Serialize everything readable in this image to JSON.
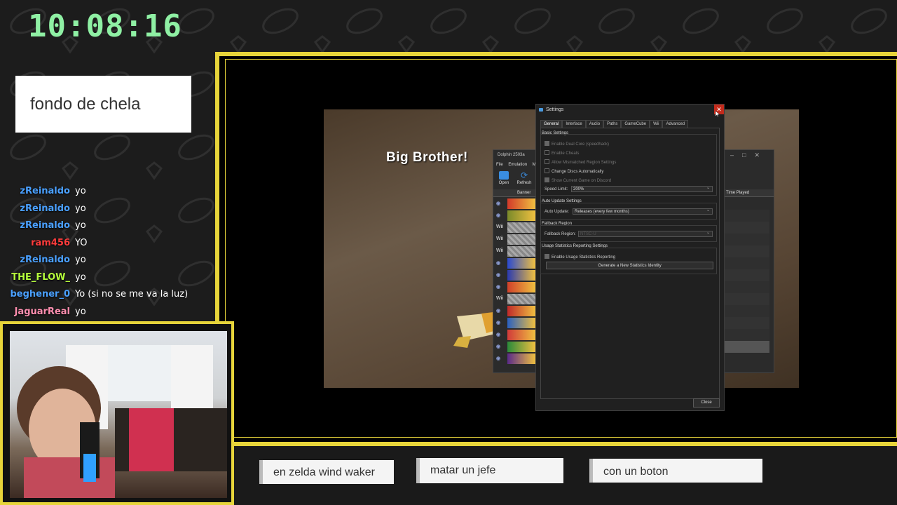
{
  "clock": "10:08:16",
  "note": "fondo de chela",
  "chat": [
    {
      "user": "zReinaldo",
      "color": "#4aa0ff",
      "msg": "yo"
    },
    {
      "user": "zReinaldo",
      "color": "#4aa0ff",
      "msg": "yo"
    },
    {
      "user": "zReinaldo",
      "color": "#4aa0ff",
      "msg": "yo"
    },
    {
      "user": "ram456",
      "color": "#ff3c3c",
      "msg": "YO"
    },
    {
      "user": "zReinaldo",
      "color": "#4aa0ff",
      "msg": "yo"
    },
    {
      "user": "THE_FLOW_",
      "color": "#b6ff3c",
      "msg": "yo"
    },
    {
      "user": "beghener_0",
      "color": "#4aa0ff",
      "msg": "Yo (si no se me va la luz)"
    },
    {
      "user": "JaguarReal",
      "color": "#ff8fb0",
      "msg": "yo"
    }
  ],
  "game": {
    "dialog": "Big Brother!"
  },
  "dolphin": {
    "title": "Dolphin 2503a",
    "menu": [
      "File",
      "Emulation",
      "M"
    ],
    "toolbar": [
      {
        "label": "Open"
      },
      {
        "label": "Refresh"
      }
    ],
    "columns": {
      "banner": "Banner",
      "time_played": "Time Played"
    },
    "rows": [
      {
        "platform": "gc"
      },
      {
        "platform": "gc"
      },
      {
        "platform": "Wii"
      },
      {
        "platform": "Wii"
      },
      {
        "platform": "Wii"
      },
      {
        "platform": "gc"
      },
      {
        "platform": "gc"
      },
      {
        "platform": "gc"
      },
      {
        "platform": "Wii"
      },
      {
        "platform": "gc"
      },
      {
        "platform": "gc"
      },
      {
        "platform": "gc"
      },
      {
        "platform": "gc"
      },
      {
        "platform": "gc"
      }
    ]
  },
  "settings": {
    "title": "Settings",
    "close_x": "✕",
    "tabs": [
      "General",
      "Interface",
      "Audio",
      "Paths",
      "GameCube",
      "Wii",
      "Advanced"
    ],
    "basic": {
      "label": "Basic Settings",
      "options": [
        {
          "text": "Enable Dual Core (speedhack)",
          "checked": true,
          "enabled": false
        },
        {
          "text": "Enable Cheats",
          "checked": false,
          "enabled": false
        },
        {
          "text": "Allow Mismatched Region Settings",
          "checked": false,
          "enabled": false
        },
        {
          "text": "Change Discs Automatically",
          "checked": false,
          "enabled": true
        },
        {
          "text": "Show Current Game on Discord",
          "checked": true,
          "enabled": false
        }
      ],
      "speed_label": "Speed Limit:",
      "speed_value": "200%"
    },
    "auto_update": {
      "label": "Auto Update Settings",
      "field": "Auto Update:",
      "value": "Releases (every few months)"
    },
    "fallback": {
      "label": "Fallback Region",
      "field": "Fallback Region:",
      "value": "NTSC-U"
    },
    "usage": {
      "label": "Usage Statistics Reporting Settings",
      "option": "Enable Usage Statistics Reporting",
      "button": "Generate a New Statistics Identity"
    },
    "close_button": "Close"
  },
  "bottom": [
    "en zelda wind waker",
    "matar un jefe",
    "con un boton"
  ]
}
